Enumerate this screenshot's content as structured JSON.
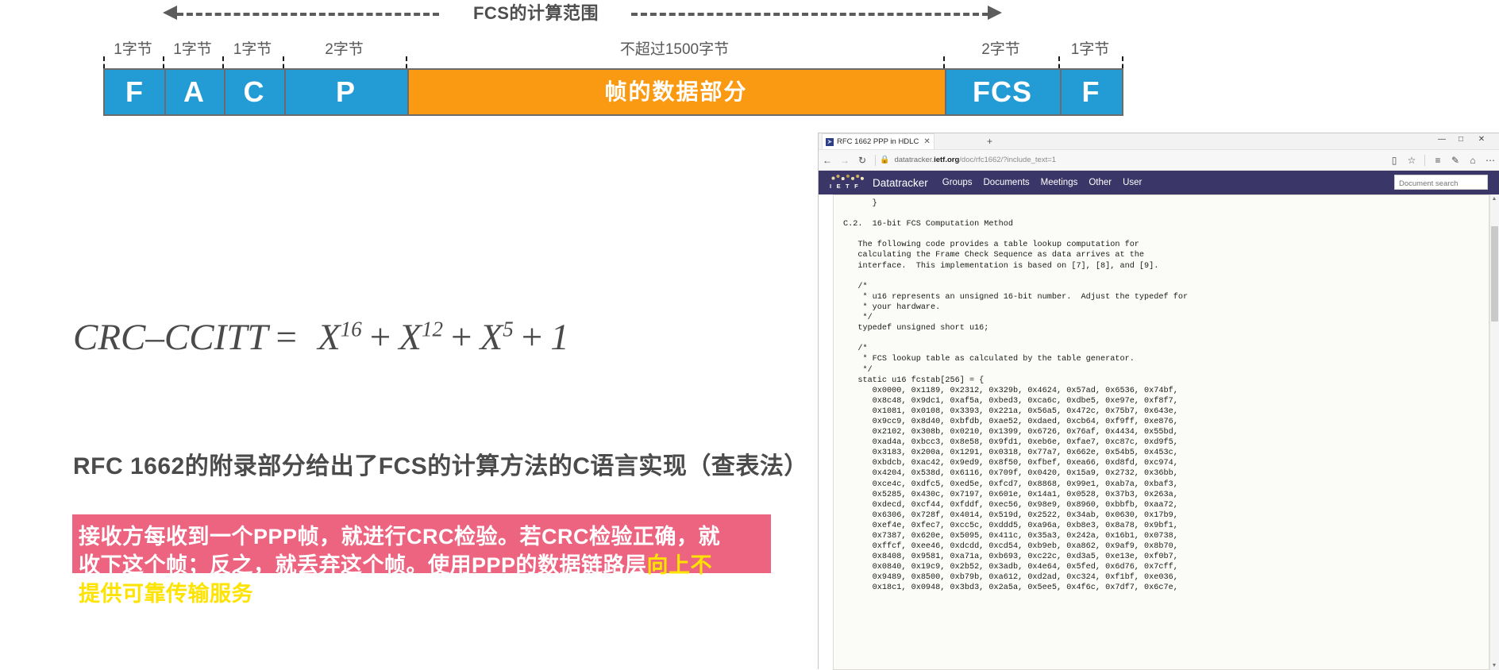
{
  "slide": {
    "frame_diagram": {
      "span_label": "FCS的计算范围",
      "byte_labels": [
        "1字节",
        "1字节",
        "1字节",
        "2字节",
        "不超过1500字节",
        "2字节",
        "1字节"
      ],
      "fields": [
        {
          "label": "F",
          "color": "#239bd4",
          "script": "latin"
        },
        {
          "label": "A",
          "color": "#239bd4",
          "script": "latin"
        },
        {
          "label": "C",
          "color": "#239bd4",
          "script": "latin"
        },
        {
          "label": "P",
          "color": "#239bd4",
          "script": "latin"
        },
        {
          "label": "帧的数据部分",
          "color": "#f99a12",
          "script": "cjk"
        },
        {
          "label": "FCS",
          "color": "#239bd4",
          "script": "latin"
        },
        {
          "label": "F",
          "color": "#239bd4",
          "script": "latin"
        }
      ]
    },
    "formula": {
      "name": "CRC–CCITT",
      "equals": "=",
      "terms": [
        "X16",
        "X12",
        "X5",
        "1"
      ],
      "plus": "+",
      "base": "X",
      "exp1": "16",
      "exp2": "12",
      "exp3": "5",
      "last": "1"
    },
    "rfc_heading": "RFC 1662的附录部分给出了FCS的计算方法的C语言实现（查表法）",
    "callout": {
      "background": "#ed6480",
      "highlight_color": "#ffe300",
      "line1": "接收方每收到一个PPP帧，就进行CRC检验。若CRC检验正确，就",
      "line2_plain": "收下这个帧；反之，就丢弃这个帧。使用PPP的数据链路层",
      "line2_highlight": "向上不",
      "line3_highlight": "提供可靠传输服务",
      "line3_plain": "。"
    }
  },
  "browser": {
    "tab": {
      "title": "RFC 1662  PPP in HDLC",
      "close": "✕",
      "favicon": "ietf-favicon"
    },
    "new_tab": "+",
    "window_controls": {
      "minimize": "—",
      "maximize": "□",
      "close": "✕"
    },
    "toolbar": {
      "back": "←",
      "forward": "→",
      "reload": "↻",
      "lock": "🔒",
      "url_prefix": "datatracker.",
      "url_host": "ietf.org",
      "url_path": "/doc/rfc1662/?include_text=1",
      "reading_list": "▯",
      "favorite": "☆",
      "hub": "≡",
      "web_note": "✎",
      "share": "⌂",
      "more": "⋯"
    },
    "ietf": {
      "logo_text": "I E T F",
      "brand": "Datatracker",
      "nav": [
        "Groups",
        "Documents",
        "Meetings",
        "Other",
        "User"
      ],
      "search_placeholder": "Document search"
    },
    "document": {
      "body": "      }\n\nC.2.  16-bit FCS Computation Method\n\n   The following code provides a table lookup computation for\n   calculating the Frame Check Sequence as data arrives at the\n   interface.  This implementation is based on [7], [8], and [9].\n\n   /*\n    * u16 represents an unsigned 16-bit number.  Adjust the typedef for\n    * your hardware.\n    */\n   typedef unsigned short u16;\n\n   /*\n    * FCS lookup table as calculated by the table generator.\n    */\n   static u16 fcstab[256] = {\n      0x0000, 0x1189, 0x2312, 0x329b, 0x4624, 0x57ad, 0x6536, 0x74bf,\n      0x8c48, 0x9dc1, 0xaf5a, 0xbed3, 0xca6c, 0xdbe5, 0xe97e, 0xf8f7,\n      0x1081, 0x0108, 0x3393, 0x221a, 0x56a5, 0x472c, 0x75b7, 0x643e,\n      0x9cc9, 0x8d40, 0xbfdb, 0xae52, 0xdaed, 0xcb64, 0xf9ff, 0xe876,\n      0x2102, 0x308b, 0x0210, 0x1399, 0x6726, 0x76af, 0x4434, 0x55bd,\n      0xad4a, 0xbcc3, 0x8e58, 0x9fd1, 0xeb6e, 0xfae7, 0xc87c, 0xd9f5,\n      0x3183, 0x200a, 0x1291, 0x0318, 0x77a7, 0x662e, 0x54b5, 0x453c,\n      0xbdcb, 0xac42, 0x9ed9, 0x8f50, 0xfbef, 0xea66, 0xd8fd, 0xc974,\n      0x4204, 0x538d, 0x6116, 0x709f, 0x0420, 0x15a9, 0x2732, 0x36bb,\n      0xce4c, 0xdfc5, 0xed5e, 0xfcd7, 0x8868, 0x99e1, 0xab7a, 0xbaf3,\n      0x5285, 0x430c, 0x7197, 0x601e, 0x14a1, 0x0528, 0x37b3, 0x263a,\n      0xdecd, 0xcf44, 0xfddf, 0xec56, 0x98e9, 0x8960, 0xbbfb, 0xaa72,\n      0x6306, 0x728f, 0x4014, 0x519d, 0x2522, 0x34ab, 0x0630, 0x17b9,\n      0xef4e, 0xfec7, 0xcc5c, 0xddd5, 0xa96a, 0xb8e3, 0x8a78, 0x9bf1,\n      0x7387, 0x620e, 0x5095, 0x411c, 0x35a3, 0x242a, 0x16b1, 0x0738,\n      0xffcf, 0xee46, 0xdcdd, 0xcd54, 0xb9eb, 0xa862, 0x9af9, 0x8b70,\n      0x8408, 0x9581, 0xa71a, 0xb693, 0xc22c, 0xd3a5, 0xe13e, 0xf0b7,\n      0x0840, 0x19c9, 0x2b52, 0x3adb, 0x4e64, 0x5fed, 0x6d76, 0x7cff,\n      0x9489, 0x8500, 0xb79b, 0xa612, 0xd2ad, 0xc324, 0xf1bf, 0xe036,\n      0x18c1, 0x0948, 0x3bd3, 0x2a5a, 0x5ee5, 0x4f6c, 0x7df7, 0x6c7e,"
    }
  }
}
